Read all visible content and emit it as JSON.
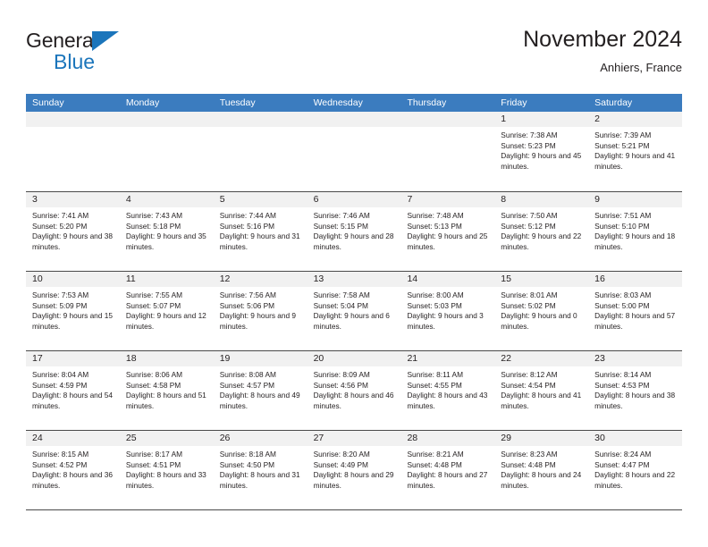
{
  "logo": {
    "word1": "General",
    "word2": "Blue",
    "triangle_color": "#1b75bb",
    "icon": "triangle-logo-icon"
  },
  "header": {
    "title": "November 2024",
    "subtitle": "Anhiers, France"
  },
  "theme": {
    "header_blue": "#3b7cbf",
    "daynum_gray": "#f1f1f1",
    "rule_color": "#4a4a4a",
    "text_color": "#231f20"
  },
  "weekdays": [
    "Sunday",
    "Monday",
    "Tuesday",
    "Wednesday",
    "Thursday",
    "Friday",
    "Saturday"
  ],
  "weeks": [
    [
      {
        "day": "",
        "sunrise": "",
        "sunset": "",
        "daylight": "",
        "empty": true
      },
      {
        "day": "",
        "sunrise": "",
        "sunset": "",
        "daylight": "",
        "empty": true
      },
      {
        "day": "",
        "sunrise": "",
        "sunset": "",
        "daylight": "",
        "empty": true
      },
      {
        "day": "",
        "sunrise": "",
        "sunset": "",
        "daylight": "",
        "empty": true
      },
      {
        "day": "",
        "sunrise": "",
        "sunset": "",
        "daylight": "",
        "empty": true
      },
      {
        "day": "1",
        "sunrise": "Sunrise: 7:38 AM",
        "sunset": "Sunset: 5:23 PM",
        "daylight": "Daylight: 9 hours and 45 minutes."
      },
      {
        "day": "2",
        "sunrise": "Sunrise: 7:39 AM",
        "sunset": "Sunset: 5:21 PM",
        "daylight": "Daylight: 9 hours and 41 minutes."
      }
    ],
    [
      {
        "day": "3",
        "sunrise": "Sunrise: 7:41 AM",
        "sunset": "Sunset: 5:20 PM",
        "daylight": "Daylight: 9 hours and 38 minutes."
      },
      {
        "day": "4",
        "sunrise": "Sunrise: 7:43 AM",
        "sunset": "Sunset: 5:18 PM",
        "daylight": "Daylight: 9 hours and 35 minutes."
      },
      {
        "day": "5",
        "sunrise": "Sunrise: 7:44 AM",
        "sunset": "Sunset: 5:16 PM",
        "daylight": "Daylight: 9 hours and 31 minutes."
      },
      {
        "day": "6",
        "sunrise": "Sunrise: 7:46 AM",
        "sunset": "Sunset: 5:15 PM",
        "daylight": "Daylight: 9 hours and 28 minutes."
      },
      {
        "day": "7",
        "sunrise": "Sunrise: 7:48 AM",
        "sunset": "Sunset: 5:13 PM",
        "daylight": "Daylight: 9 hours and 25 minutes."
      },
      {
        "day": "8",
        "sunrise": "Sunrise: 7:50 AM",
        "sunset": "Sunset: 5:12 PM",
        "daylight": "Daylight: 9 hours and 22 minutes."
      },
      {
        "day": "9",
        "sunrise": "Sunrise: 7:51 AM",
        "sunset": "Sunset: 5:10 PM",
        "daylight": "Daylight: 9 hours and 18 minutes."
      }
    ],
    [
      {
        "day": "10",
        "sunrise": "Sunrise: 7:53 AM",
        "sunset": "Sunset: 5:09 PM",
        "daylight": "Daylight: 9 hours and 15 minutes."
      },
      {
        "day": "11",
        "sunrise": "Sunrise: 7:55 AM",
        "sunset": "Sunset: 5:07 PM",
        "daylight": "Daylight: 9 hours and 12 minutes."
      },
      {
        "day": "12",
        "sunrise": "Sunrise: 7:56 AM",
        "sunset": "Sunset: 5:06 PM",
        "daylight": "Daylight: 9 hours and 9 minutes."
      },
      {
        "day": "13",
        "sunrise": "Sunrise: 7:58 AM",
        "sunset": "Sunset: 5:04 PM",
        "daylight": "Daylight: 9 hours and 6 minutes."
      },
      {
        "day": "14",
        "sunrise": "Sunrise: 8:00 AM",
        "sunset": "Sunset: 5:03 PM",
        "daylight": "Daylight: 9 hours and 3 minutes."
      },
      {
        "day": "15",
        "sunrise": "Sunrise: 8:01 AM",
        "sunset": "Sunset: 5:02 PM",
        "daylight": "Daylight: 9 hours and 0 minutes."
      },
      {
        "day": "16",
        "sunrise": "Sunrise: 8:03 AM",
        "sunset": "Sunset: 5:00 PM",
        "daylight": "Daylight: 8 hours and 57 minutes."
      }
    ],
    [
      {
        "day": "17",
        "sunrise": "Sunrise: 8:04 AM",
        "sunset": "Sunset: 4:59 PM",
        "daylight": "Daylight: 8 hours and 54 minutes."
      },
      {
        "day": "18",
        "sunrise": "Sunrise: 8:06 AM",
        "sunset": "Sunset: 4:58 PM",
        "daylight": "Daylight: 8 hours and 51 minutes."
      },
      {
        "day": "19",
        "sunrise": "Sunrise: 8:08 AM",
        "sunset": "Sunset: 4:57 PM",
        "daylight": "Daylight: 8 hours and 49 minutes."
      },
      {
        "day": "20",
        "sunrise": "Sunrise: 8:09 AM",
        "sunset": "Sunset: 4:56 PM",
        "daylight": "Daylight: 8 hours and 46 minutes."
      },
      {
        "day": "21",
        "sunrise": "Sunrise: 8:11 AM",
        "sunset": "Sunset: 4:55 PM",
        "daylight": "Daylight: 8 hours and 43 minutes."
      },
      {
        "day": "22",
        "sunrise": "Sunrise: 8:12 AM",
        "sunset": "Sunset: 4:54 PM",
        "daylight": "Daylight: 8 hours and 41 minutes."
      },
      {
        "day": "23",
        "sunrise": "Sunrise: 8:14 AM",
        "sunset": "Sunset: 4:53 PM",
        "daylight": "Daylight: 8 hours and 38 minutes."
      }
    ],
    [
      {
        "day": "24",
        "sunrise": "Sunrise: 8:15 AM",
        "sunset": "Sunset: 4:52 PM",
        "daylight": "Daylight: 8 hours and 36 minutes."
      },
      {
        "day": "25",
        "sunrise": "Sunrise: 8:17 AM",
        "sunset": "Sunset: 4:51 PM",
        "daylight": "Daylight: 8 hours and 33 minutes."
      },
      {
        "day": "26",
        "sunrise": "Sunrise: 8:18 AM",
        "sunset": "Sunset: 4:50 PM",
        "daylight": "Daylight: 8 hours and 31 minutes."
      },
      {
        "day": "27",
        "sunrise": "Sunrise: 8:20 AM",
        "sunset": "Sunset: 4:49 PM",
        "daylight": "Daylight: 8 hours and 29 minutes."
      },
      {
        "day": "28",
        "sunrise": "Sunrise: 8:21 AM",
        "sunset": "Sunset: 4:48 PM",
        "daylight": "Daylight: 8 hours and 27 minutes."
      },
      {
        "day": "29",
        "sunrise": "Sunrise: 8:23 AM",
        "sunset": "Sunset: 4:48 PM",
        "daylight": "Daylight: 8 hours and 24 minutes."
      },
      {
        "day": "30",
        "sunrise": "Sunrise: 8:24 AM",
        "sunset": "Sunset: 4:47 PM",
        "daylight": "Daylight: 8 hours and 22 minutes."
      }
    ]
  ]
}
